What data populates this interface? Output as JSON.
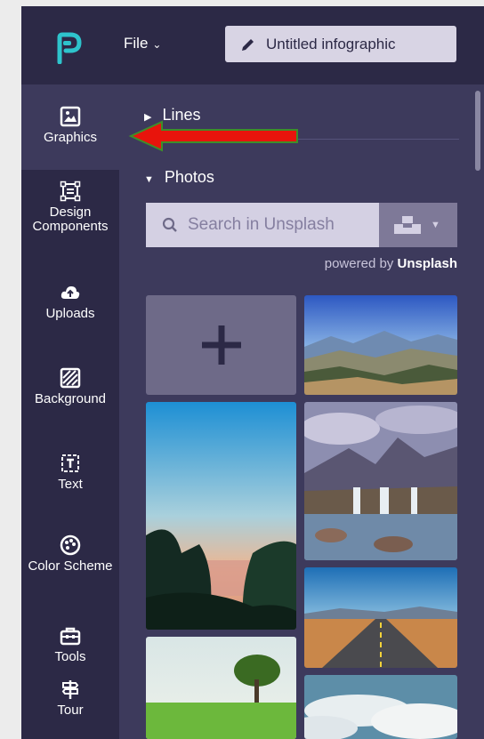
{
  "header": {
    "file_label": "File",
    "document_title": "Untitled infographic"
  },
  "sidebar": {
    "items": [
      {
        "label": "Graphics",
        "icon": "image-icon",
        "active": true
      },
      {
        "label": "Design Components",
        "icon": "components-icon",
        "active": false
      },
      {
        "label": "Uploads",
        "icon": "cloud-upload-icon",
        "active": false
      },
      {
        "label": "Background",
        "icon": "background-icon",
        "active": false
      },
      {
        "label": "Text",
        "icon": "text-icon",
        "active": false
      },
      {
        "label": "Color Scheme",
        "icon": "palette-icon",
        "active": false
      },
      {
        "label": "Tools",
        "icon": "toolbox-icon",
        "active": false
      },
      {
        "label": "Tour",
        "icon": "signpost-icon",
        "active": false
      }
    ]
  },
  "panel": {
    "sections": [
      {
        "label": "Lines",
        "expanded": false
      },
      {
        "label": "Photos",
        "expanded": true
      }
    ],
    "search": {
      "placeholder": "Search in Unsplash",
      "source_icon": "unsplash-icon"
    },
    "powered_by_prefix": "powered by",
    "powered_by_brand": "Unsplash",
    "upload_tile_icon": "plus-icon",
    "photos": [
      {
        "subject": "mountain-valley-photo"
      },
      {
        "subject": "sunset-palm-lake-photo"
      },
      {
        "subject": "waterfall-mountains-photo"
      },
      {
        "subject": "desert-road-photo"
      },
      {
        "subject": "lone-tree-meadow-photo"
      },
      {
        "subject": "clouds-photo"
      }
    ]
  },
  "colors": {
    "app_background": "#2c2946",
    "panel_background": "#3d3a5c",
    "logo_accent": "#2ec4cc",
    "annotation_arrow": "#e8140c"
  }
}
